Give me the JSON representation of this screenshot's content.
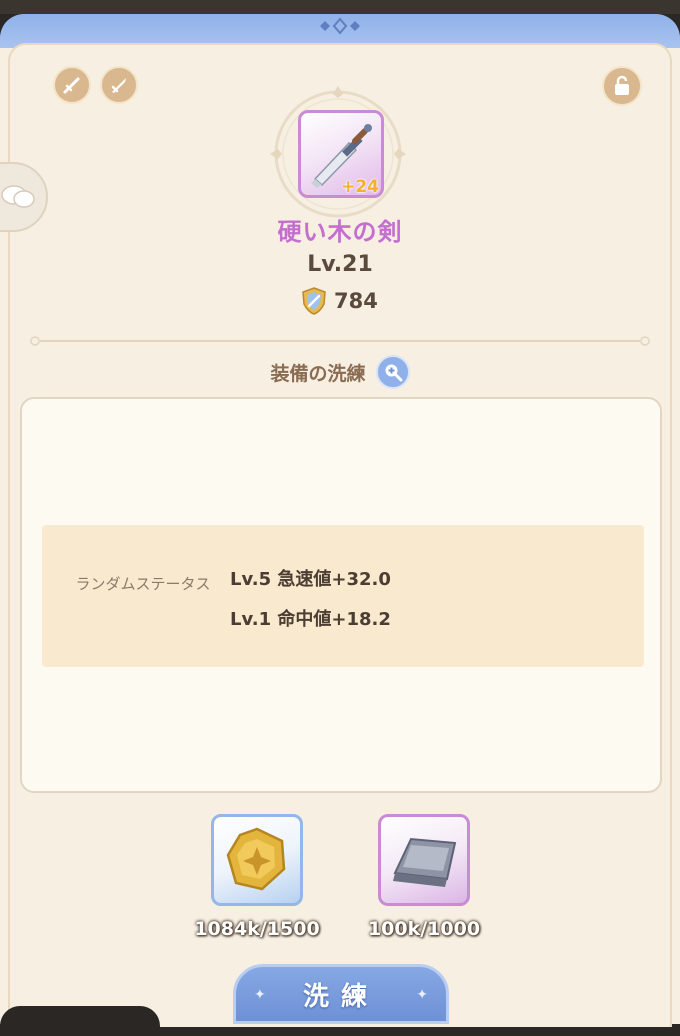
{
  "item": {
    "name": "硬い木の剣",
    "plus": "+24",
    "level": "Lv.21",
    "power": "784"
  },
  "section": {
    "title": "装備の洗練"
  },
  "random_status": {
    "label": "ランダムステータス",
    "lines": [
      "Lv.5 急速値+32.0",
      "Lv.1 命中値+18.2"
    ]
  },
  "materials": [
    {
      "name": "gold-coin",
      "count": "1084k/1500"
    },
    {
      "name": "iron-ingot",
      "count": "100k/1000"
    }
  ],
  "buttons": {
    "refine": "洗練"
  },
  "colors": {
    "accent_blue": "#8fb1ea",
    "item_name_purple": "#c46fd0",
    "panel_bg": "#f6efe2",
    "status_bg": "#f8e9cf"
  }
}
